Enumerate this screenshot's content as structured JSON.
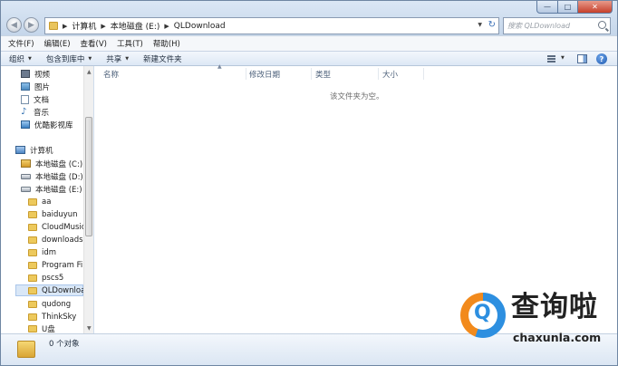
{
  "window": {
    "caption_buttons": {
      "minimize": "—",
      "maximize": "□",
      "close": "✕"
    }
  },
  "address": {
    "breadcrumbs": [
      "计算机",
      "本地磁盘 (E:)",
      "QLDownload"
    ],
    "refresh_icon": "refresh-icon"
  },
  "search": {
    "placeholder": "搜索 QLDownload"
  },
  "menu": [
    "文件(F)",
    "编辑(E)",
    "查看(V)",
    "工具(T)",
    "帮助(H)"
  ],
  "toolbar": {
    "organize": "组织",
    "include_in_library": "包含到库中",
    "share": "共享",
    "new_folder": "新建文件夹",
    "help_label": "?"
  },
  "nav_pane": {
    "libraries": [
      {
        "label": "视频",
        "icon": "video-icon"
      },
      {
        "label": "图片",
        "icon": "picture-icon"
      },
      {
        "label": "文档",
        "icon": "document-icon"
      },
      {
        "label": "音乐",
        "icon": "music-icon"
      },
      {
        "label": "优酷影视库",
        "icon": "video-library-icon"
      }
    ],
    "computer": {
      "label": "计算机",
      "icon": "computer-icon"
    },
    "drives": [
      {
        "label": "本地磁盘 (C:)"
      },
      {
        "label": "本地磁盘 (D:)"
      },
      {
        "label": "本地磁盘 (E:)"
      }
    ],
    "folders": [
      "aa",
      "baiduyun",
      "CloudMusic",
      "downloads",
      "idm",
      "Program Files",
      "pscs5",
      "QLDownload",
      "qudong",
      "ThinkSky",
      "U盘"
    ],
    "selected": "QLDownload"
  },
  "content": {
    "columns": [
      "名称",
      "修改日期",
      "类型",
      "大小"
    ],
    "empty_message": "该文件夹为空。"
  },
  "status": {
    "item_count": "0 个对象"
  },
  "watermark": {
    "title": "查询啦",
    "url": "chaxunla.com",
    "letter": "Q"
  }
}
